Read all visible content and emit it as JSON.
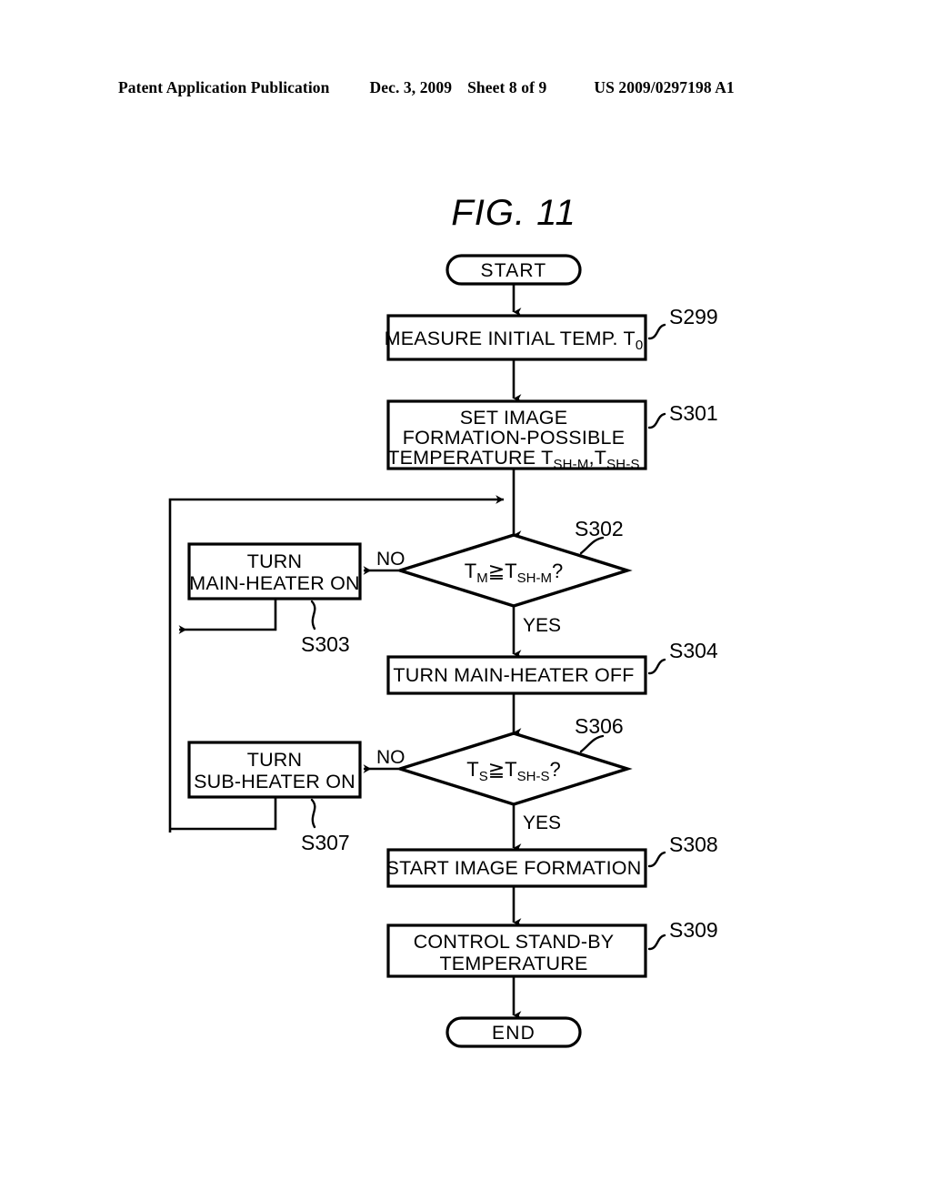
{
  "header": {
    "publication": "Patent Application Publication",
    "date": "Dec. 3, 2009",
    "sheet": "Sheet 8 of 9",
    "patent_number": "US 2009/0297198 A1"
  },
  "figure": {
    "title": "FIG.  11",
    "ink_color": "#000000",
    "paper_color": "#ffffff"
  },
  "flowchart": {
    "start": {
      "label": "START"
    },
    "end": {
      "label": "END"
    },
    "steps": [
      {
        "id": "S299",
        "step_label": "S299",
        "shape": "process",
        "lines": [
          {
            "text": "MEASURE INITIAL TEMP. T",
            "sub": "0"
          }
        ]
      },
      {
        "id": "S301",
        "step_label": "S301",
        "shape": "process",
        "lines": [
          {
            "text": "SET IMAGE"
          },
          {
            "text": "FORMATION-POSSIBLE"
          },
          {
            "text": "TEMPERATURE T",
            "sub": "SH-M",
            "text2": ",T",
            "sub2": "SH-S"
          }
        ]
      },
      {
        "id": "S302",
        "step_label": "S302",
        "shape": "decision",
        "condition_left": "T",
        "condition_left_sub": "M",
        "condition_op": "≧",
        "condition_right": "T",
        "condition_right_sub": "SH-M",
        "condition_tail": "?",
        "branch_no": "NO",
        "branch_yes": "YES"
      },
      {
        "id": "S303",
        "step_label": "S303",
        "shape": "process",
        "lines": [
          {
            "text": "TURN"
          },
          {
            "text": "MAIN-HEATER ON"
          }
        ]
      },
      {
        "id": "S304",
        "step_label": "S304",
        "shape": "process",
        "lines": [
          {
            "text": "TURN MAIN-HEATER OFF"
          }
        ]
      },
      {
        "id": "S306",
        "step_label": "S306",
        "shape": "decision",
        "condition_left": "T",
        "condition_left_sub": "S",
        "condition_op": "≧",
        "condition_right": "T",
        "condition_right_sub": "SH-S",
        "condition_tail": "?",
        "branch_no": "NO",
        "branch_yes": "YES"
      },
      {
        "id": "S307",
        "step_label": "S307",
        "shape": "process",
        "lines": [
          {
            "text": "TURN"
          },
          {
            "text": "SUB-HEATER ON"
          }
        ]
      },
      {
        "id": "S308",
        "step_label": "S308",
        "shape": "process",
        "lines": [
          {
            "text": "START IMAGE FORMATION"
          }
        ]
      },
      {
        "id": "S309",
        "step_label": "S309",
        "shape": "process",
        "lines": [
          {
            "text": "CONTROL STAND-BY"
          },
          {
            "text": "TEMPERATURE"
          }
        ]
      }
    ]
  }
}
